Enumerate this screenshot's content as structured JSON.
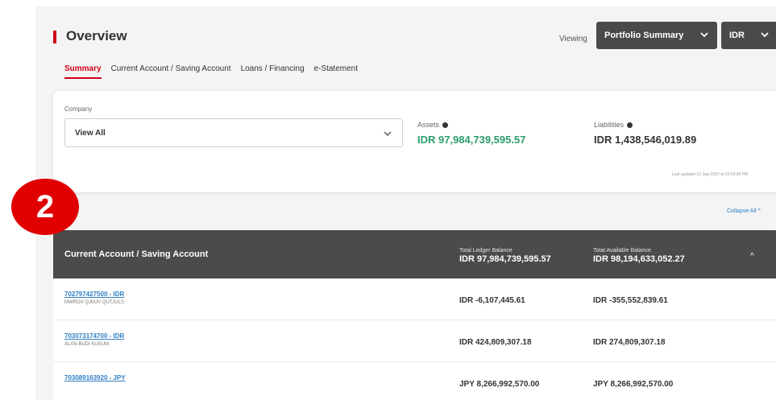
{
  "header": {
    "title": "Overview",
    "viewing_label": "Viewing",
    "portfolio_select": "Portfolio Summary",
    "currency_select": "IDR"
  },
  "tabs": [
    {
      "label": "Summary",
      "active": true
    },
    {
      "label": "Current Account / Saving Account",
      "active": false
    },
    {
      "label": "Loans / Financing",
      "active": false
    },
    {
      "label": "e-Statement",
      "active": false
    }
  ],
  "summary": {
    "company_label": "Company",
    "company_value": "View All",
    "assets_label": "Assets",
    "assets_value": "IDR 97,984,739,595.57",
    "liabilities_label": "Liabilities",
    "liabilities_value": "IDR 1,438,546,019.89",
    "last_updated": "Last updated 19 Sep 2023 at 03:54:34 PM"
  },
  "collapse_all": "Collapse All ^",
  "account_panel": {
    "title": "Current Account / Saving Account",
    "ledger_label": "Total Ledger Balance",
    "ledger_value": "IDR 97,984,739,595.57",
    "available_label": "Total Available Balance",
    "available_value": "IDR 98,194,633,052.27",
    "rows": [
      {
        "account": "702797427500 - IDR",
        "name": "MWROX QJMJV QUTJULS",
        "ledger": "IDR -6,107,445.61",
        "available": "IDR -355,552,839.61"
      },
      {
        "account": "703073174700 - IDR",
        "name": "ALAN BUDI KUSUM",
        "ledger": "IDR 424,809,307.18",
        "available": "IDR 274,809,307.18"
      },
      {
        "account": "703089163920 - JPY",
        "name": "",
        "ledger": "JPY 8,266,992,570.00",
        "available": "JPY 8,266,992,570.00"
      }
    ]
  },
  "badge": "2",
  "colors": {
    "accent": "#d0021b",
    "assets_green": "#2a9d6a",
    "link_blue": "#2f7fc2",
    "panel_dark": "#4b4b4b"
  }
}
